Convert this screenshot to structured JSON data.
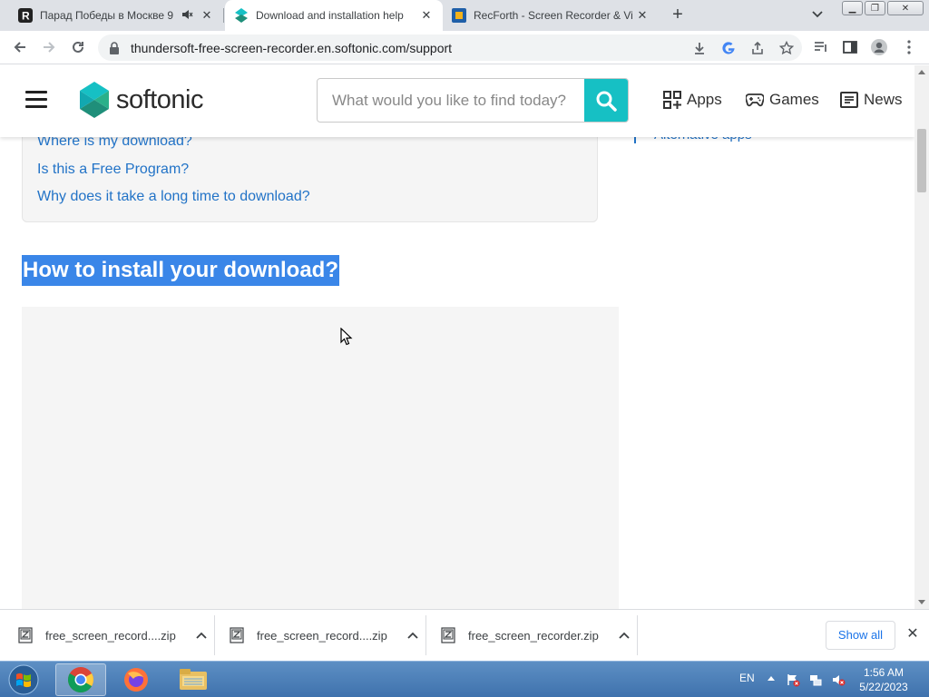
{
  "browser": {
    "tabs": [
      {
        "title": "Парад Победы в Москве 9",
        "active": false
      },
      {
        "title": "Download and installation help",
        "active": true
      },
      {
        "title": "RecForth - Screen Recorder & Vi",
        "active": false
      }
    ],
    "address": "thundersoft-free-screen-recorder.en.softonic.com/support"
  },
  "site": {
    "logo_text": "softonic",
    "search_placeholder": "What would you like to find today?",
    "nav": [
      "Apps",
      "Games",
      "News"
    ]
  },
  "page": {
    "faq_links": [
      "Where is my download?",
      "Is this a Free Program?",
      "Why does it take a long time to download?"
    ],
    "sidebar_link": "Alternative apps",
    "section_title": "How to install your download?"
  },
  "downloads": {
    "items": [
      "free_screen_record....zip",
      "free_screen_record....zip",
      "free_screen_recorder.zip"
    ],
    "show_all": "Show all"
  },
  "taskbar": {
    "lang": "EN",
    "time": "1:56 AM",
    "date": "5/22/2023"
  },
  "colors": {
    "accent": "#16c0c4",
    "link": "#2273c7",
    "selection": "#3a86e8",
    "taskbar": "#4a7fb8"
  }
}
